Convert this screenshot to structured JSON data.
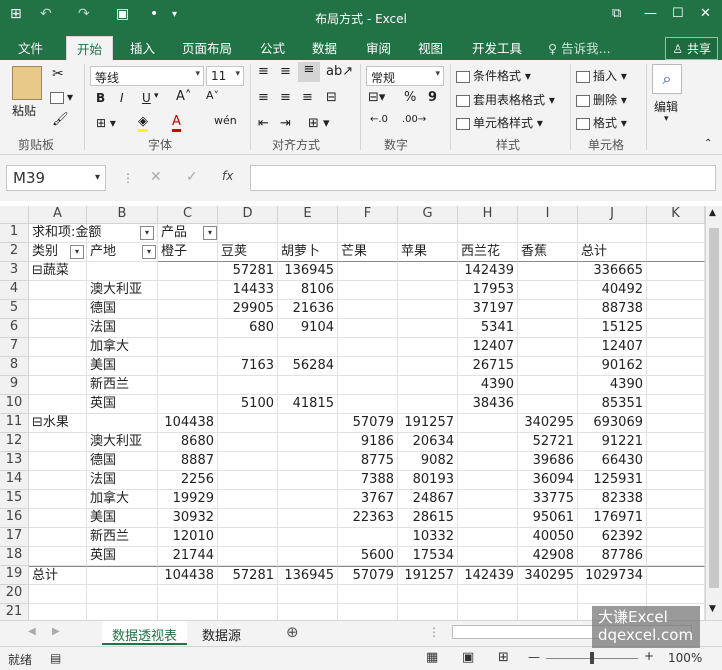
{
  "titlebar": {
    "title": "布局方式 - Excel",
    "qa": [
      "⊞",
      "↶",
      "↷",
      "▣",
      "•",
      "▾"
    ],
    "window_ctrl": [
      "⧉",
      "—",
      "☐",
      "✕"
    ]
  },
  "tabs": [
    "文件",
    "开始",
    "插入",
    "页面布局",
    "公式",
    "数据",
    "审阅",
    "视图",
    "开发工具"
  ],
  "tell_me": "告诉我...",
  "share": "共享",
  "ribbon": {
    "paste": "粘贴",
    "font_name": "等线",
    "font_size": "11",
    "number_format": "常规",
    "cond_format": "条件格式",
    "table_format": "套用表格格式",
    "cell_style": "单元格样式",
    "insert": "插入",
    "delete": "删除",
    "format": "格式",
    "edit": "编辑",
    "groups": [
      "剪贴板",
      "字体",
      "对齐方式",
      "数字",
      "样式",
      "单元格"
    ],
    "bold": "B",
    "italic": "I",
    "underline": "U",
    "percent": "%",
    "comma": "9",
    "wen": "wén"
  },
  "formula_bar": {
    "name_box": "M39",
    "fx": "fx",
    "value": ""
  },
  "columns": [
    "A",
    "B",
    "C",
    "D",
    "E",
    "F",
    "G",
    "H",
    "I",
    "J",
    "K"
  ],
  "rows": [
    [
      "求和项:金额",
      "",
      "产品",
      "",
      "",
      "",
      "",
      "",
      "",
      ""
    ],
    [
      "类别",
      "产地",
      "橙子",
      "豆荚",
      "胡萝卜",
      "芒果",
      "苹果",
      "西兰花",
      "香蕉",
      "总计"
    ],
    [
      "⊟蔬菜",
      "",
      "",
      "57281",
      "136945",
      "",
      "",
      "142439",
      "",
      "336665"
    ],
    [
      "",
      "澳大利亚",
      "",
      "14433",
      "8106",
      "",
      "",
      "17953",
      "",
      "40492"
    ],
    [
      "",
      "德国",
      "",
      "29905",
      "21636",
      "",
      "",
      "37197",
      "",
      "88738"
    ],
    [
      "",
      "法国",
      "",
      "680",
      "9104",
      "",
      "",
      "5341",
      "",
      "15125"
    ],
    [
      "",
      "加拿大",
      "",
      "",
      "",
      "",
      "",
      "12407",
      "",
      "12407"
    ],
    [
      "",
      "美国",
      "",
      "7163",
      "56284",
      "",
      "",
      "26715",
      "",
      "90162"
    ],
    [
      "",
      "新西兰",
      "",
      "",
      "",
      "",
      "",
      "4390",
      "",
      "4390"
    ],
    [
      "",
      "英国",
      "",
      "5100",
      "41815",
      "",
      "",
      "38436",
      "",
      "85351"
    ],
    [
      "⊟水果",
      "",
      "104438",
      "",
      "",
      "57079",
      "191257",
      "",
      "340295",
      "693069"
    ],
    [
      "",
      "澳大利亚",
      "8680",
      "",
      "",
      "9186",
      "20634",
      "",
      "52721",
      "91221"
    ],
    [
      "",
      "德国",
      "8887",
      "",
      "",
      "8775",
      "9082",
      "",
      "39686",
      "66430"
    ],
    [
      "",
      "法国",
      "2256",
      "",
      "",
      "7388",
      "80193",
      "",
      "36094",
      "125931"
    ],
    [
      "",
      "加拿大",
      "19929",
      "",
      "",
      "3767",
      "24867",
      "",
      "33775",
      "82338"
    ],
    [
      "",
      "美国",
      "30932",
      "",
      "",
      "22363",
      "28615",
      "",
      "95061",
      "176971"
    ],
    [
      "",
      "新西兰",
      "12010",
      "",
      "",
      "",
      "10332",
      "",
      "40050",
      "62392"
    ],
    [
      "",
      "英国",
      "21744",
      "",
      "",
      "5600",
      "17534",
      "",
      "42908",
      "87786"
    ],
    [
      "总计",
      "",
      "104438",
      "57281",
      "136945",
      "57079",
      "191257",
      "142439",
      "340295",
      "1029734"
    ],
    [
      "",
      "",
      "",
      "",
      "",
      "",
      "",
      "",
      "",
      ""
    ],
    [
      "",
      "",
      "",
      "",
      "",
      "",
      "",
      "",
      "",
      ""
    ]
  ],
  "sheets": [
    "数据透视表",
    "数据源"
  ],
  "status": {
    "ready": "就绪",
    "zoom": "100%"
  },
  "watermark": [
    "大谦Excel",
    "dqexcel.com"
  ],
  "colors": {
    "brand": "#217346"
  }
}
